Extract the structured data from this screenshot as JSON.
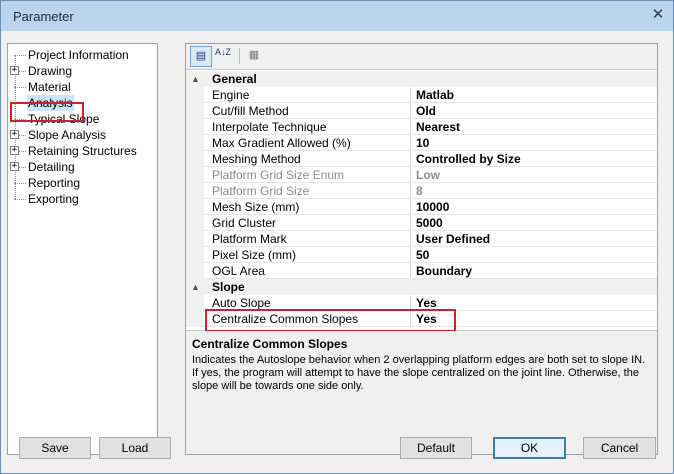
{
  "window": {
    "title": "Parameter",
    "close_glyph": "✕"
  },
  "tree": {
    "items": [
      {
        "label": "Project Information",
        "expandable": false
      },
      {
        "label": "Drawing",
        "expandable": true
      },
      {
        "label": "Material",
        "expandable": false
      },
      {
        "label": "Analysis",
        "expandable": false,
        "selected": true
      },
      {
        "label": "Typical Slope",
        "expandable": false
      },
      {
        "label": "Slope Analysis",
        "expandable": true
      },
      {
        "label": "Retaining Structures",
        "expandable": true
      },
      {
        "label": "Detailing",
        "expandable": true
      },
      {
        "label": "Reporting",
        "expandable": false
      },
      {
        "label": "Exporting",
        "expandable": false
      }
    ],
    "expand_glyph": "+"
  },
  "toolbar": {
    "categorized_icon": "▤",
    "alphabetical_icon": "A↓Z",
    "property_pages_icon": "▦"
  },
  "grid": {
    "categories": [
      {
        "name": "General",
        "rows": [
          {
            "name": "Engine",
            "value": "Matlab",
            "enabled": true
          },
          {
            "name": "Cut/fill Method",
            "value": "Old",
            "enabled": true
          },
          {
            "name": "Interpolate Technique",
            "value": "Nearest",
            "enabled": true
          },
          {
            "name": "Max Gradient Allowed (%)",
            "value": "10",
            "enabled": true
          },
          {
            "name": "Meshing Method",
            "value": "Controlled by Size",
            "enabled": true
          },
          {
            "name": "Platform Grid Size Enum",
            "value": "Low",
            "enabled": false
          },
          {
            "name": "Platform Grid Size",
            "value": "8",
            "enabled": false
          },
          {
            "name": "Mesh Size (mm)",
            "value": "10000",
            "enabled": true
          },
          {
            "name": "Grid Cluster",
            "value": "5000",
            "enabled": true
          },
          {
            "name": "Platform Mark",
            "value": "User Defined",
            "enabled": true
          },
          {
            "name": "Pixel Size (mm)",
            "value": "50",
            "enabled": true
          },
          {
            "name": "OGL Area",
            "value": "Boundary",
            "enabled": true
          }
        ]
      },
      {
        "name": "Slope",
        "rows": [
          {
            "name": "Auto Slope",
            "value": "Yes",
            "enabled": true
          },
          {
            "name": "Centralize Common Slopes",
            "value": "Yes",
            "enabled": true
          }
        ]
      }
    ],
    "collapse_glyph": "▲"
  },
  "description": {
    "title": "Centralize Common Slopes",
    "text": "Indicates the Autoslope behavior when 2 overlapping platform edges are both set to slope IN. If yes, the program will attempt to have the slope centralized on the joint line. Otherwise, the slope will be towards one side only."
  },
  "buttons": {
    "save": "Save",
    "load": "Load",
    "default": "Default",
    "ok": "OK",
    "cancel": "Cancel"
  },
  "colors": {
    "titlebar": "#bcd3ee",
    "highlight_box": "#d0212b",
    "selection": "#cce4f7",
    "disabled_text": "#8c8c8c"
  }
}
